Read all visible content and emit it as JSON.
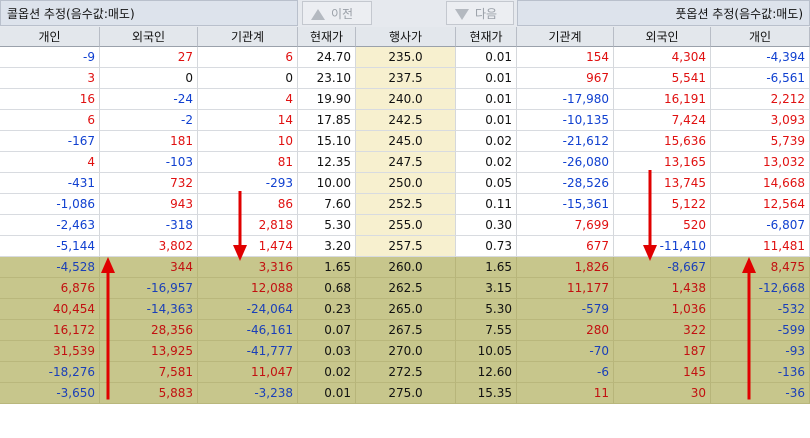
{
  "header": {
    "call_title": "콜옵션 추정(음수값:매도)",
    "put_title": "풋옵션 추정(음수값:매도)",
    "prev_label": "이전",
    "next_label": "다음"
  },
  "columns": [
    "개인",
    "외국인",
    "기관계",
    "현재가",
    "행사가",
    "현재가",
    "기관계",
    "외국인",
    "개인"
  ],
  "colors": {
    "positive": "#e01010",
    "negative": "#1040d0",
    "arrow": "#e00000",
    "itm_bg": "#c7c68c",
    "strike_bg": "#f7f0cf"
  },
  "rows": [
    {
      "call_individual": "-9",
      "call_foreign": "27",
      "call_institution": "6",
      "call_price": "24.70",
      "strike": "235.0",
      "put_price": "0.01",
      "put_institution": "154",
      "put_foreign": "4,304",
      "put_individual": "-4,394",
      "zone": "otm"
    },
    {
      "call_individual": "3",
      "call_foreign": "0",
      "call_institution": "0",
      "call_price": "23.10",
      "strike": "237.5",
      "put_price": "0.01",
      "put_institution": "967",
      "put_foreign": "5,541",
      "put_individual": "-6,561",
      "zone": "otm"
    },
    {
      "call_individual": "16",
      "call_foreign": "-24",
      "call_institution": "4",
      "call_price": "19.90",
      "strike": "240.0",
      "put_price": "0.01",
      "put_institution": "-17,980",
      "put_foreign": "16,191",
      "put_individual": "2,212",
      "zone": "otm"
    },
    {
      "call_individual": "6",
      "call_foreign": "-2",
      "call_institution": "14",
      "call_price": "17.85",
      "strike": "242.5",
      "put_price": "0.01",
      "put_institution": "-10,135",
      "put_foreign": "7,424",
      "put_individual": "3,093",
      "zone": "otm"
    },
    {
      "call_individual": "-167",
      "call_foreign": "181",
      "call_institution": "10",
      "call_price": "15.10",
      "strike": "245.0",
      "put_price": "0.02",
      "put_institution": "-21,612",
      "put_foreign": "15,636",
      "put_individual": "5,739",
      "zone": "otm"
    },
    {
      "call_individual": "4",
      "call_foreign": "-103",
      "call_institution": "81",
      "call_price": "12.35",
      "strike": "247.5",
      "put_price": "0.02",
      "put_institution": "-26,080",
      "put_foreign": "13,165",
      "put_individual": "13,032",
      "zone": "otm"
    },
    {
      "call_individual": "-431",
      "call_foreign": "732",
      "call_institution": "-293",
      "call_price": "10.00",
      "strike": "250.0",
      "put_price": "0.05",
      "put_institution": "-28,526",
      "put_foreign": "13,745",
      "put_individual": "14,668",
      "zone": "otm"
    },
    {
      "call_individual": "-1,086",
      "call_foreign": "943",
      "call_institution": "86",
      "call_price": "7.60",
      "strike": "252.5",
      "put_price": "0.11",
      "put_institution": "-15,361",
      "put_foreign": "5,122",
      "put_individual": "12,564",
      "zone": "otm"
    },
    {
      "call_individual": "-2,463",
      "call_foreign": "-318",
      "call_institution": "2,818",
      "call_price": "5.30",
      "strike": "255.0",
      "put_price": "0.30",
      "put_institution": "7,699",
      "put_foreign": "520",
      "put_individual": "-6,807",
      "zone": "otm"
    },
    {
      "call_individual": "-5,144",
      "call_foreign": "3,802",
      "call_institution": "1,474",
      "call_price": "3.20",
      "strike": "257.5",
      "put_price": "0.73",
      "put_institution": "677",
      "put_foreign": "-11,410",
      "put_individual": "11,481",
      "zone": "otm"
    },
    {
      "call_individual": "-4,528",
      "call_foreign": "344",
      "call_institution": "3,316",
      "call_price": "1.65",
      "strike": "260.0",
      "put_price": "1.65",
      "put_institution": "1,826",
      "put_foreign": "-8,667",
      "put_individual": "8,475",
      "zone": "itm"
    },
    {
      "call_individual": "6,876",
      "call_foreign": "-16,957",
      "call_institution": "12,088",
      "call_price": "0.68",
      "strike": "262.5",
      "put_price": "3.15",
      "put_institution": "11,177",
      "put_foreign": "1,438",
      "put_individual": "-12,668",
      "zone": "itm"
    },
    {
      "call_individual": "40,454",
      "call_foreign": "-14,363",
      "call_institution": "-24,064",
      "call_price": "0.23",
      "strike": "265.0",
      "put_price": "5.30",
      "put_institution": "-579",
      "put_foreign": "1,036",
      "put_individual": "-532",
      "zone": "itm"
    },
    {
      "call_individual": "16,172",
      "call_foreign": "28,356",
      "call_institution": "-46,161",
      "call_price": "0.07",
      "strike": "267.5",
      "put_price": "7.55",
      "put_institution": "280",
      "put_foreign": "322",
      "put_individual": "-599",
      "zone": "itm"
    },
    {
      "call_individual": "31,539",
      "call_foreign": "13,925",
      "call_institution": "-41,777",
      "call_price": "0.03",
      "strike": "270.0",
      "put_price": "10.05",
      "put_institution": "-70",
      "put_foreign": "187",
      "put_individual": "-93",
      "zone": "itm"
    },
    {
      "call_individual": "-18,276",
      "call_foreign": "7,581",
      "call_institution": "11,047",
      "call_price": "0.02",
      "strike": "272.5",
      "put_price": "12.60",
      "put_institution": "-6",
      "put_foreign": "145",
      "put_individual": "-136",
      "zone": "itm"
    },
    {
      "call_individual": "-3,650",
      "call_foreign": "5,883",
      "call_institution": "-3,238",
      "call_price": "0.01",
      "strike": "275.0",
      "put_price": "15.35",
      "put_institution": "11",
      "put_foreign": "30",
      "put_individual": "-36",
      "zone": "itm"
    }
  ],
  "annotations": [
    {
      "icon": "arrow-up-icon",
      "column": "call_individual",
      "from_row": 16,
      "to_row": 10
    },
    {
      "icon": "arrow-down-icon",
      "column": "call_institution",
      "from_row": 8,
      "to_row": 10
    },
    {
      "icon": "arrow-down-icon",
      "column": "put_foreign",
      "from_row": 7,
      "to_row": 10
    },
    {
      "icon": "arrow-up-icon",
      "column": "put_individual",
      "from_row": 16,
      "to_row": 10
    }
  ]
}
